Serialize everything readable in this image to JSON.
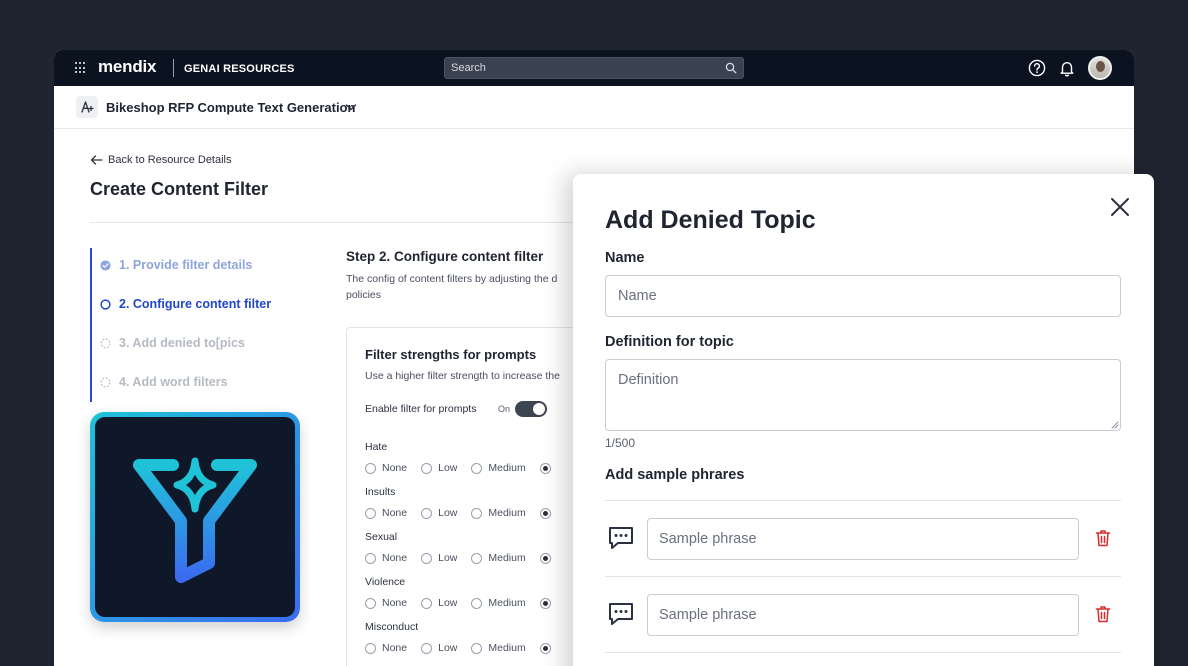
{
  "topbar": {
    "brand": "mendix",
    "product": "GENAI RESOURCES",
    "search_placeholder": "Search"
  },
  "subbar": {
    "app_name": "Bikeshop RFP Compute Text Generation"
  },
  "page": {
    "back_link": "Back to Resource Details",
    "title": "Create Content Filter"
  },
  "steps": [
    {
      "label": "1.  Provide filter details",
      "state": "done"
    },
    {
      "label": "2.  Configure content filter",
      "state": "active"
    },
    {
      "label": "3.  Add denied to[pics",
      "state": "todo"
    },
    {
      "label": "4.  Add word filters",
      "state": "todo"
    }
  ],
  "step2": {
    "title": "Step 2. Configure content filter",
    "description": "The config of content filters by adjusting the d policies"
  },
  "filter_card": {
    "title": "Filter strengths for prompts",
    "description": "Use a higher filter strength to increase the",
    "toggle_label": "Enable filter for prompts",
    "toggle_state": "On",
    "options": [
      "None",
      "Low",
      "Medium"
    ],
    "categories": [
      {
        "name": "Hate",
        "selected": "High"
      },
      {
        "name": "Insults",
        "selected": "High"
      },
      {
        "name": "Sexual",
        "selected": "High"
      },
      {
        "name": "Violence",
        "selected": "High"
      },
      {
        "name": "Misconduct",
        "selected": "High"
      }
    ]
  },
  "modal": {
    "title": "Add Denied Topic",
    "name_label": "Name",
    "name_placeholder": "Name",
    "definition_label": "Definition for topic",
    "definition_placeholder": "Definition",
    "char_count": "1/500",
    "phrases_label": "Add sample phrares",
    "phrase_placeholder": "Sample phrase"
  },
  "colors": {
    "topbar": "#0b1220",
    "accent": "#264ae5",
    "delete": "#d92d2d",
    "background": "#1f2430"
  }
}
